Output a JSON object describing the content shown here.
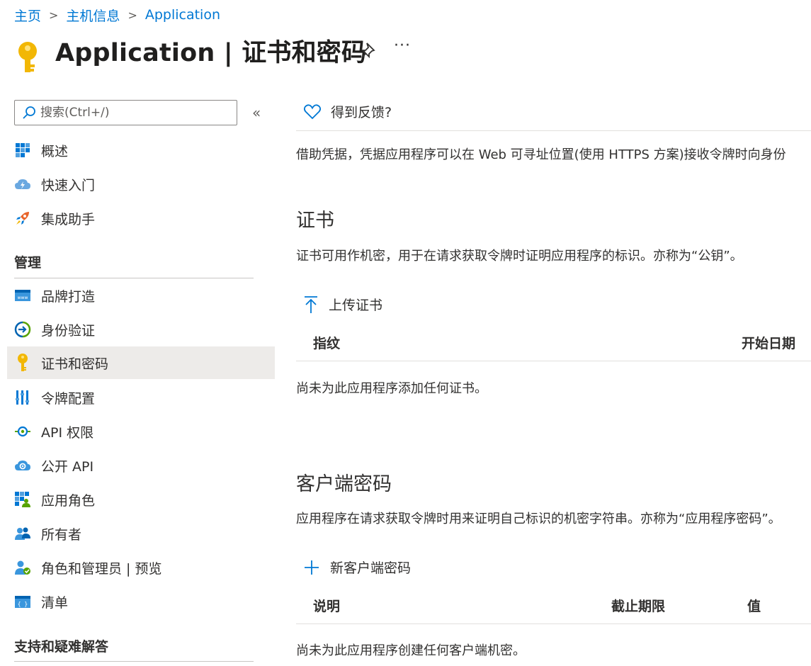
{
  "breadcrumb": {
    "home": "主页",
    "host": "主机信息",
    "app": "Application"
  },
  "header": {
    "title": "Application | 证书和密码",
    "more": "···"
  },
  "sidebar": {
    "search_placeholder": "搜索(Ctrl+/)",
    "collapse": "«",
    "top_items": [
      {
        "label": "概述",
        "icon": "overview-grid-icon"
      },
      {
        "label": "快速入门",
        "icon": "quickstart-cloud-icon"
      },
      {
        "label": "集成助手",
        "icon": "rocket-icon"
      }
    ],
    "manage_header": "管理",
    "manage_items": [
      {
        "label": "品牌打造",
        "icon": "branding-www-icon"
      },
      {
        "label": "身份验证",
        "icon": "authentication-icon"
      },
      {
        "label": "证书和密码",
        "icon": "key-icon",
        "active": true
      },
      {
        "label": "令牌配置",
        "icon": "token-config-icon"
      },
      {
        "label": "API 权限",
        "icon": "api-permissions-icon"
      },
      {
        "label": "公开 API",
        "icon": "expose-api-cloud-icon"
      },
      {
        "label": "应用角色",
        "icon": "app-roles-icon"
      },
      {
        "label": "所有者",
        "icon": "owners-icon"
      },
      {
        "label": "角色和管理员 | 预览",
        "icon": "roles-admins-icon"
      },
      {
        "label": "清单",
        "icon": "manifest-icon"
      }
    ],
    "support_header": "支持和疑难解答"
  },
  "main": {
    "feedback": "得到反馈?",
    "intro": "借助凭据，凭据应用程序可以在 Web 可寻址位置(使用 HTTPS 方案)接收令牌时向身份",
    "certificates": {
      "title": "证书",
      "description": "证书可用作机密，用于在请求获取令牌时证明应用程序的标识。亦称为“公钥”。",
      "upload_button": "上传证书",
      "columns": [
        "指纹",
        "开始日期"
      ],
      "empty": "尚未为此应用程序添加任何证书。"
    },
    "client_secrets": {
      "title": "客户端密码",
      "description": "应用程序在请求获取令牌时用来证明自己标识的机密字符串。亦称为“应用程序密码”。",
      "new_button": "新客户端密码",
      "columns": [
        "说明",
        "截止期限",
        "值"
      ],
      "empty": "尚未为此应用程序创建任何客户端机密。"
    }
  },
  "colors": {
    "accent": "#0078d4",
    "key": "#f2b705",
    "active_bg": "#edebe9"
  }
}
